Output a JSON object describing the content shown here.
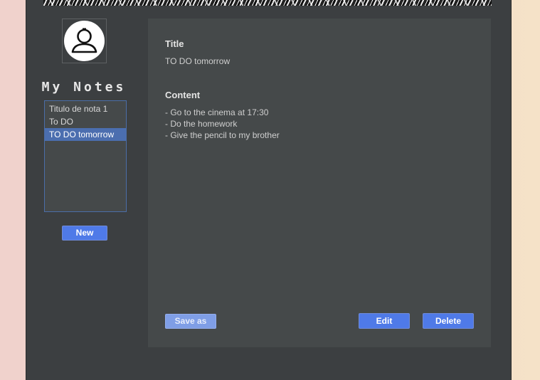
{
  "sidebar": {
    "title": "My Notes",
    "notes": [
      {
        "title": "Titulo de nota 1",
        "selected": false
      },
      {
        "title": "To DO",
        "selected": false
      },
      {
        "title": "TO DO tomorrow",
        "selected": true
      }
    ],
    "new_label": "New"
  },
  "note": {
    "title_label": "Title",
    "title_value": "TO DO tomorrow",
    "content_label": "Content",
    "content_lines": [
      "- Go to the cinema at 17:30",
      "- Do the homework",
      "- Give the pencil to my brother"
    ]
  },
  "actions": {
    "save_as_label": "Save as",
    "edit_label": "Edit",
    "delete_label": "Delete"
  },
  "icons": {
    "avatar": "user-avatar-icon"
  },
  "colors": {
    "accent": "#4f7ae8",
    "selection": "#4b6eaf",
    "window_bg": "#3c3f41",
    "panel_bg": "#45494a"
  }
}
